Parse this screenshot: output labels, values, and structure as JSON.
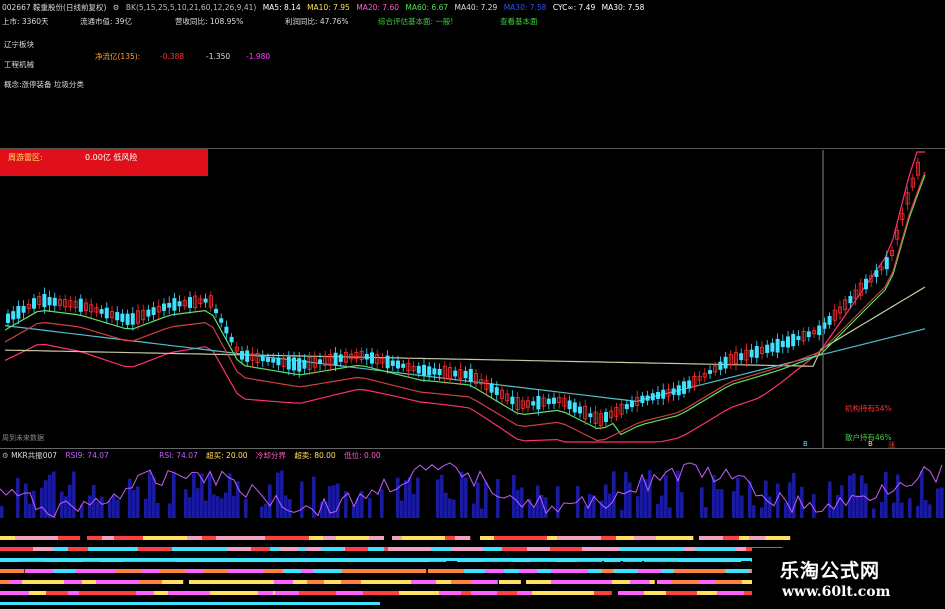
{
  "header": {
    "stock": "002667 鞍重股份(日线前复权)",
    "indicator": "BK(5,15,25,5,10,21,60,12,26,9,41)",
    "ma5": "MA5: 8.14",
    "ma10": "MA10: 7.95",
    "ma20": "MA20: 7.60",
    "ma60": "MA60: 6.67",
    "ma40": "MA40: 7.29",
    "hidden": "MA30: 7.58",
    "cyc": "CYC∞: 7.49",
    "ma30": "MA30: 7.58"
  },
  "info": {
    "listed": "上市: 3360天",
    "float_mv": "流通市值: 39亿",
    "rev_yoy": "营收同比: 108.95%",
    "profit_yoy": "利润同比: 47.76%",
    "rating": "综合评估基本面: 一般!",
    "view": "查看基本面",
    "region": "辽宁板块",
    "industry": "工程机械",
    "fund_label": "净流亿(135):",
    "fund_v1": "-0.388",
    "fund_v2": "-1.350",
    "fund_v3": "-1.980",
    "concept": "概念:涨停装备 垃圾分类"
  },
  "alert": {
    "label": "周游雷区:",
    "value": "0.00亿 低风险"
  },
  "chart_labels": {
    "bottom_left": "周到未来数据",
    "inst": "机构持有54%",
    "retail": "散户持有46%",
    "b1": "B",
    "b2": "B",
    "zhang": "涨"
  },
  "indicator_panel": {
    "name": "MKR共振007",
    "rsi_a": "RSI9: 74.07",
    "rsi_b": "RSI: 74.07",
    "buy_label": "超买: 20.00",
    "cold_label": "冷却分界",
    "sell_label": "超卖: 80.00",
    "low": "低位: 0.00"
  },
  "watermark": {
    "line1": "乐淘公式网",
    "line2": "www.60lt.com"
  },
  "colors": {
    "up": "#ff3030",
    "down": "#40e0ff",
    "ma_yellow": "#ffffff",
    "ma_pink": "#ff3070",
    "ma_green": "#60e060",
    "ma_cyan": "#50c0d0",
    "ma_gray": "#c8c8a0",
    "bars": "#1a1aa0",
    "rsi": "#c060ff"
  }
}
